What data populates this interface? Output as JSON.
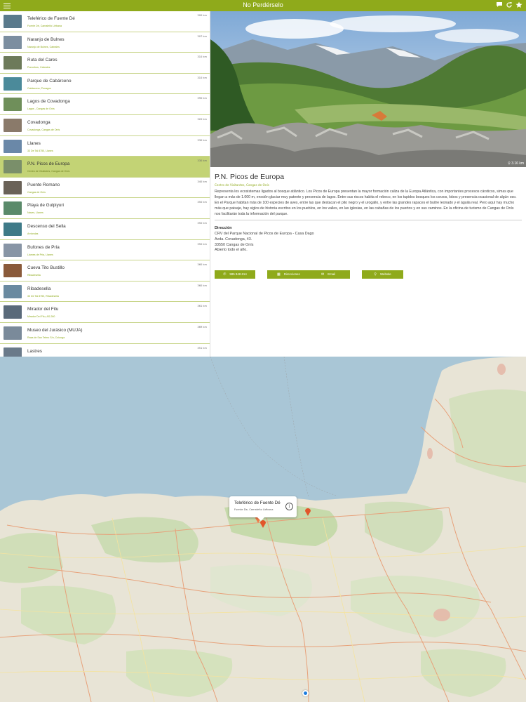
{
  "app": {
    "title": "No Perdérselo"
  },
  "colors": {
    "accent": "#8faa1b",
    "selected_row": "#c3d375",
    "pin": "#e2552a",
    "user_dot": "#1c7cde"
  },
  "topbar_icons": [
    "menu-icon",
    "chat-icon",
    "refresh-icon",
    "star-icon"
  ],
  "list": [
    {
      "name": "Teleférico de Fuente Dé",
      "sub": "Fuente Dé, Camaleño Liébana",
      "dist": "300 km",
      "thumb": "#5a7a8c"
    },
    {
      "name": "Naranjo de Bulnes",
      "sub": "Naranjo de Bulnes, Cabrales",
      "dist": "307 km",
      "thumb": "#7c8ea0"
    },
    {
      "name": "Ruta del Cares",
      "sub": "Poncebos, Cabrales",
      "dist": "310 km",
      "thumb": "#6d7a5a"
    },
    {
      "name": "Parque de Cabárceno",
      "sub": "Cabárceno, Penagos",
      "dist": "310 km",
      "thumb": "#4b8a9a"
    },
    {
      "name": "Lagos de Covadonga",
      "sub": "Lagos , Cangas de Onís",
      "dist": "390 km",
      "thumb": "#6f8f5a"
    },
    {
      "name": "Covadonga",
      "sub": "Covadonga, Cangas de Onís",
      "dist": "320 km",
      "thumb": "#8a7a6a"
    },
    {
      "name": "Llanes",
      "sub": "33 De Tal 8750, Llanes",
      "dist": "330 km",
      "thumb": "#6a88a8"
    },
    {
      "name": "P.N. Picos de Europa",
      "sub": "Centro de Visitantes, Cangas de Onís",
      "dist": "330 km",
      "thumb": "#7a8f6a"
    },
    {
      "name": "Puente Romano",
      "sub": "Cangas de Onís",
      "dist": "340 km",
      "thumb": "#6a6258"
    },
    {
      "name": "Playa de Gulpiyuri",
      "sub": "Naves, Llanes",
      "dist": "350 km",
      "thumb": "#5a8a6a"
    },
    {
      "name": "Descenso del Sella",
      "sub": "Arriondas",
      "dist": "350 km",
      "thumb": "#3e7a88"
    },
    {
      "name": "Bufones de Pría",
      "sub": "Llames de Pría, Llanes",
      "dist": "350 km",
      "thumb": "#8895a5"
    },
    {
      "name": "Cueva Tito Bustillo",
      "sub": "Ribadesella",
      "dist": "360 km",
      "thumb": "#8a5a3a"
    },
    {
      "name": "Ribadesella",
      "sub": "33 De Tal 8750, Ribadesella",
      "dist": "360 km",
      "thumb": "#6a8aa0"
    },
    {
      "name": "Mirador del Fitu",
      "sub": "Mirador Del Fitu, AS-260",
      "dist": "361 km",
      "thumb": "#5a6a7a"
    },
    {
      "name": "Museo del Jurásico (MUJA)",
      "sub": "Rasa de San Telmo S/n, Colunga",
      "dist": "369 km",
      "thumb": "#7a8a9a"
    },
    {
      "name": "Lastres",
      "sub": "Lastres, Colunga",
      "dist": "351 km",
      "thumb": "#6a7a8a"
    }
  ],
  "detail": {
    "title": "P.N. Picos de Europa",
    "subtitle": "Centro de Visitantes, Cangas de Onís",
    "photo_caption": "3.16 km",
    "description": "Representa los ecosistemas ligados al bosque atlántico. Los Picos de Europa presentan la mayor formación caliza de la Europa Atlántica, con importantes procesos cársticos, simas que llegan a más de 1.000 m, erosión glaciar muy patente y presencia de lagos. Entre sus riscos habita el rebeco, en los tupidos bosques los corzos, lobos y presencia ocasional de algún oso. En el Parque habitan más de 100 especies de aves, entre las que destacan el pito negro y el urogallo, y entre las grandes rapaces el buitre leonado y el águila real. Pero aquí hay mucho más que paisaje, hay siglos de historia escritos en los pueblos, en los valles, en las iglesias, en las cabañas de los puertos y en sus caminos. En la oficina de turismo de Cangas de Onís nos facilitarán toda la información del parque.",
    "address_label": "Dirección",
    "address_lines": [
      "CRV del Parque Nacional de Picos de Europa - Casa Dago",
      "Avda. Covadonga, 43.",
      "33550 Cangas de Onís",
      "Abierto todo el año."
    ],
    "buttons": [
      {
        "label": "985 848 614",
        "icon": "phone-icon"
      },
      {
        "label": "Direcciones",
        "icon": "directions-icon"
      },
      {
        "label": "Email",
        "icon": "email-icon"
      },
      {
        "label": "Website",
        "icon": "link-icon"
      }
    ]
  },
  "map": {
    "popup_title": "Teleférico de Fuente Dé",
    "popup_sub": "Fuente De, Camaleño Liébana"
  }
}
